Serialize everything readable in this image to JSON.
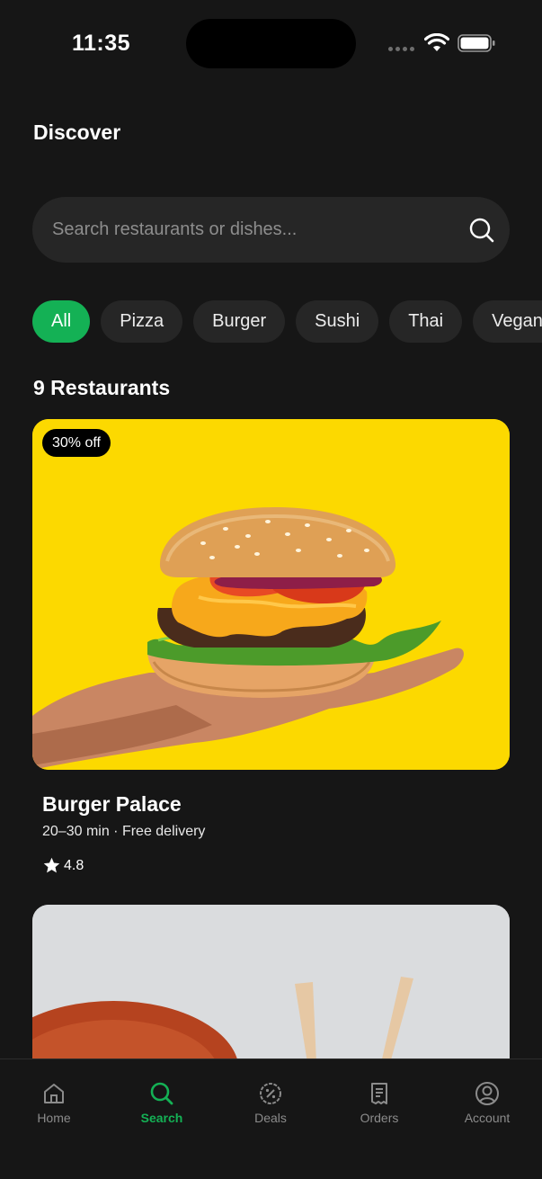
{
  "status": {
    "time": "11:35"
  },
  "header": {
    "title": "Discover"
  },
  "search": {
    "placeholder": "Search restaurants or dishes..."
  },
  "categories": [
    "All",
    "Pizza",
    "Burger",
    "Sushi",
    "Thai",
    "Vegan"
  ],
  "selected_category": "All",
  "results": {
    "count_label": "9 Restaurants"
  },
  "restaurants": [
    {
      "name": "Burger Palace",
      "badge": "30% off",
      "meta": "20–30 min · Free delivery",
      "rating": "4.8",
      "image": "burger-photo"
    },
    {
      "image": "sushi-chopsticks-photo"
    }
  ],
  "bottom_nav": [
    {
      "label": "Home",
      "icon": "home-icon"
    },
    {
      "label": "Search",
      "icon": "search-icon"
    },
    {
      "label": "Deals",
      "icon": "deals-icon"
    },
    {
      "label": "Orders",
      "icon": "receipt-icon"
    },
    {
      "label": "Account",
      "icon": "account-icon"
    }
  ],
  "colors": {
    "accent": "#14b155",
    "background": "#161616",
    "surface": "#262626",
    "card_bg": "#fcd900"
  }
}
